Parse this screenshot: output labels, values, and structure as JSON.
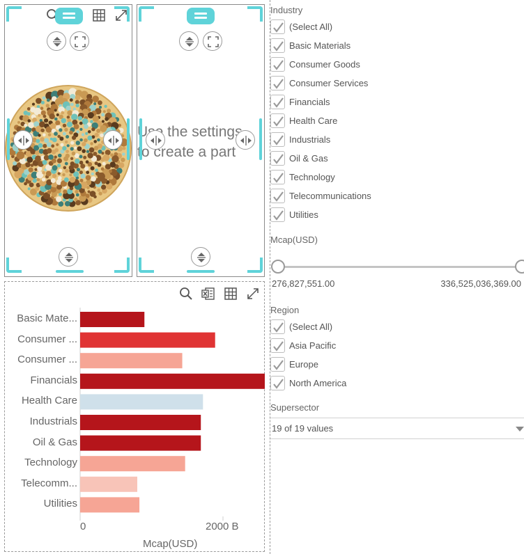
{
  "industry_filter": {
    "title": "Industry",
    "options": [
      {
        "label": "(Select All)",
        "checked": true
      },
      {
        "label": "Basic Materials",
        "checked": true
      },
      {
        "label": "Consumer Goods",
        "checked": true
      },
      {
        "label": "Consumer Services",
        "checked": true
      },
      {
        "label": "Financials",
        "checked": true
      },
      {
        "label": "Health Care",
        "checked": true
      },
      {
        "label": "Industrials",
        "checked": true
      },
      {
        "label": "Oil & Gas",
        "checked": true
      },
      {
        "label": "Technology",
        "checked": true
      },
      {
        "label": "Telecommunications",
        "checked": true
      },
      {
        "label": "Utilities",
        "checked": true
      }
    ]
  },
  "mcap_filter": {
    "title": "Mcap(USD)",
    "min_value": "276,827,551.00",
    "max_value": "336,525,036,369.00"
  },
  "region_filter": {
    "title": "Region",
    "options": [
      {
        "label": "(Select All)",
        "checked": true
      },
      {
        "label": "Asia Pacific",
        "checked": true
      },
      {
        "label": "Europe",
        "checked": true
      },
      {
        "label": "North America",
        "checked": true
      }
    ]
  },
  "supersector_filter": {
    "title": "Supersector",
    "selected": "19 of 19 values"
  },
  "empty_panel": {
    "message_line1": "Use the settings",
    "message_line2": "to create a part"
  },
  "colors": {
    "accent": "#5fd3d9",
    "bar_dark_red": "#b5151b",
    "bar_red": "#e03434",
    "bar_salmon": "#f6a595",
    "bar_pale_pink": "#f8c4b8",
    "bar_light_blue": "#cfe0ea"
  },
  "icons": {
    "search": "search-icon",
    "excel": "excel-export-icon",
    "table": "table-view-icon",
    "expand": "expand-icon",
    "sort": "sort-icon",
    "fullscreen": "fullscreen-icon",
    "resize": "resize-horizontal-icon"
  },
  "chart_data": {
    "type": "bar",
    "orientation": "horizontal",
    "categories": [
      "Basic Mate...",
      "Consumer ...",
      "Consumer ...",
      "Financials",
      "Health Care",
      "Industrials",
      "Oil & Gas",
      "Technology",
      "Telecomm...",
      "Utilities"
    ],
    "values": [
      900,
      1890,
      1430,
      2600,
      1720,
      1690,
      1690,
      1470,
      800,
      830
    ],
    "colors": [
      "#b5151b",
      "#e03434",
      "#f6a595",
      "#b5151b",
      "#cfe0ea",
      "#b5151b",
      "#b5151b",
      "#f6a595",
      "#f8c4b8",
      "#f6a595"
    ],
    "xlabel": "Mcap(USD)",
    "ylabel": "",
    "xticks": [
      "0",
      "2000 B"
    ],
    "xlim": [
      0,
      2600
    ],
    "grid": false
  }
}
